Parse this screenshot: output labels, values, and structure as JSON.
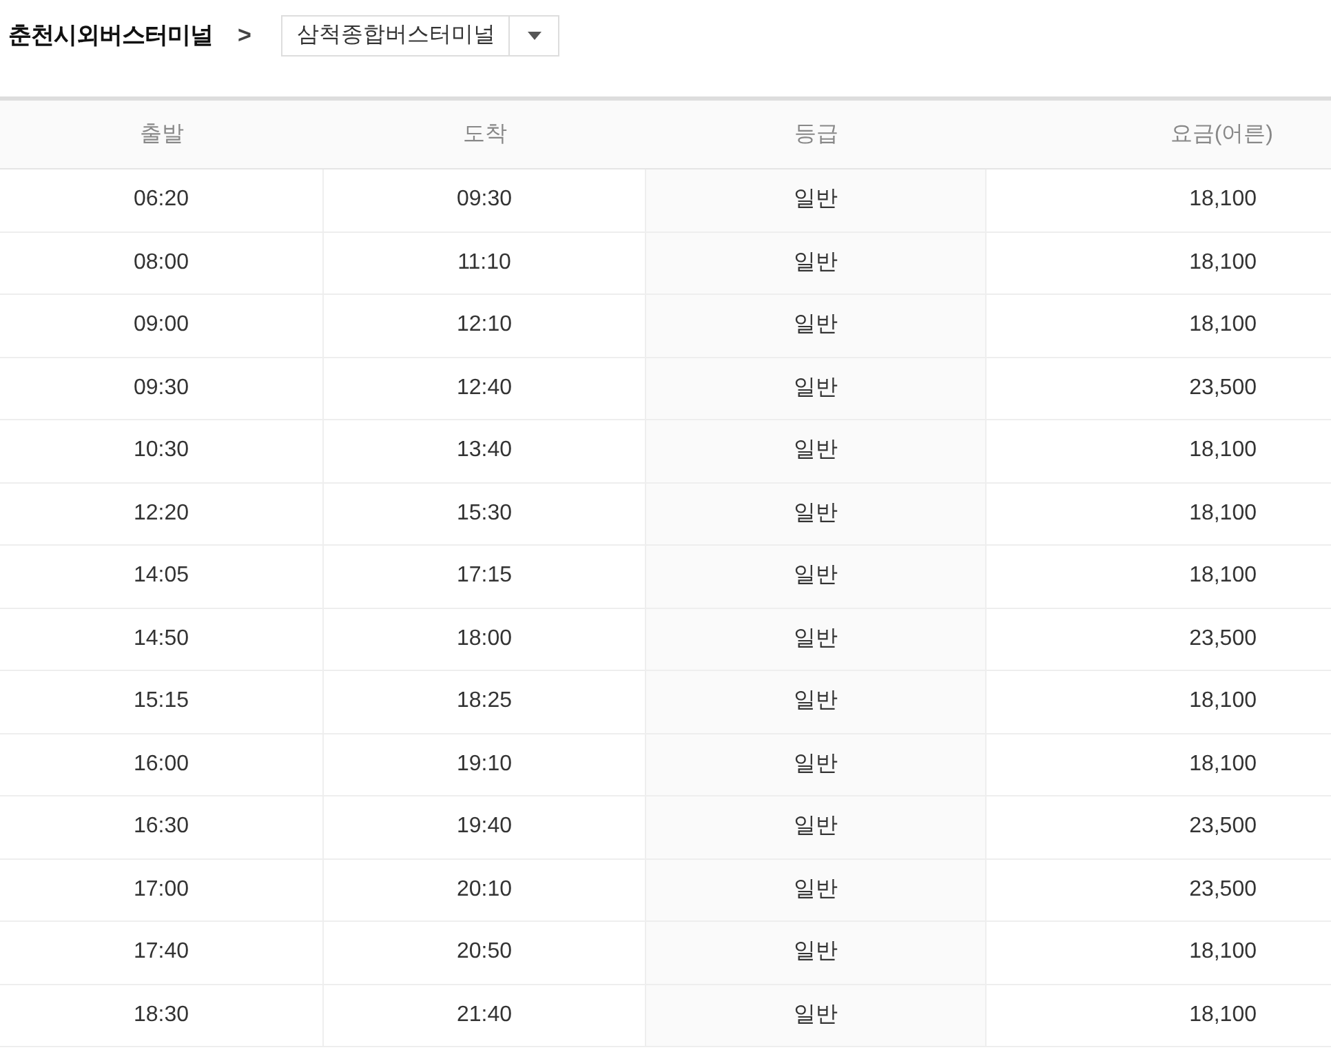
{
  "route": {
    "origin": "춘천시외버스터미널",
    "separator": ">",
    "destination": "삼척종합버스터미널"
  },
  "table": {
    "columns": [
      "출발",
      "도착",
      "등급",
      "요금(어른)"
    ],
    "rows": [
      [
        "06:20",
        "09:30",
        "일반",
        "18,100"
      ],
      [
        "08:00",
        "11:10",
        "일반",
        "18,100"
      ],
      [
        "09:00",
        "12:10",
        "일반",
        "18,100"
      ],
      [
        "09:30",
        "12:40",
        "일반",
        "23,500"
      ],
      [
        "10:30",
        "13:40",
        "일반",
        "18,100"
      ],
      [
        "12:20",
        "15:30",
        "일반",
        "18,100"
      ],
      [
        "14:05",
        "17:15",
        "일반",
        "18,100"
      ],
      [
        "14:50",
        "18:00",
        "일반",
        "23,500"
      ],
      [
        "15:15",
        "18:25",
        "일반",
        "18,100"
      ],
      [
        "16:00",
        "19:10",
        "일반",
        "18,100"
      ],
      [
        "16:30",
        "19:40",
        "일반",
        "23,500"
      ],
      [
        "17:00",
        "20:10",
        "일반",
        "23,500"
      ],
      [
        "17:40",
        "20:50",
        "일반",
        "18,100"
      ],
      [
        "18:30",
        "21:40",
        "일반",
        "18,100"
      ]
    ]
  }
}
